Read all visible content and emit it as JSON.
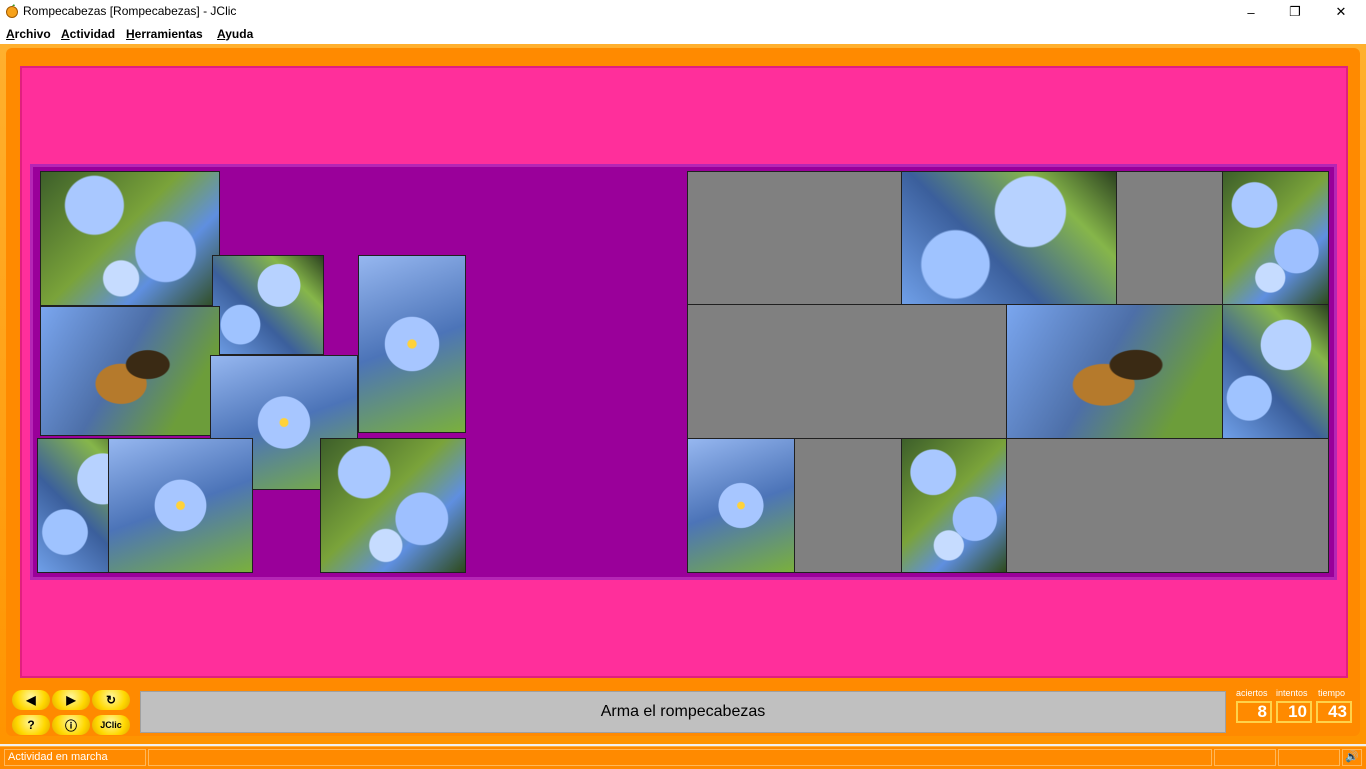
{
  "window": {
    "title": "Rompecabezas [Rompecabezas] - JClic",
    "minimize_label": "–",
    "maximize_label": "❐",
    "close_label": "✕"
  },
  "menu": [
    {
      "label": "Archivo",
      "u": "A",
      "rest": "rchivo"
    },
    {
      "label": "Actividad",
      "u": "A",
      "rest": "ctividad"
    },
    {
      "label": "Herramientas",
      "u": "H",
      "rest": "erramientas"
    },
    {
      "label": "Ayuda",
      "u": "A",
      "rest": "yuda"
    }
  ],
  "controls": {
    "prev": "◀",
    "next": "▶",
    "reset": "↻",
    "help": "?",
    "info": "ⓘ",
    "jclic": "JClic"
  },
  "message": "Arma el rompecabezas",
  "counters": {
    "aciertos_label": "aciertos",
    "intentos_label": "intentos",
    "tiempo_label": "tiempo",
    "aciertos": "8",
    "intentos": "10",
    "tiempo": "43"
  },
  "status": {
    "text": "Actividad en marcha",
    "sound_icon": "🔊"
  },
  "colors": {
    "frame": "#ff8a00",
    "background": "#ff2f9b",
    "board": "#9a009a",
    "empty_slot": "#808080"
  }
}
